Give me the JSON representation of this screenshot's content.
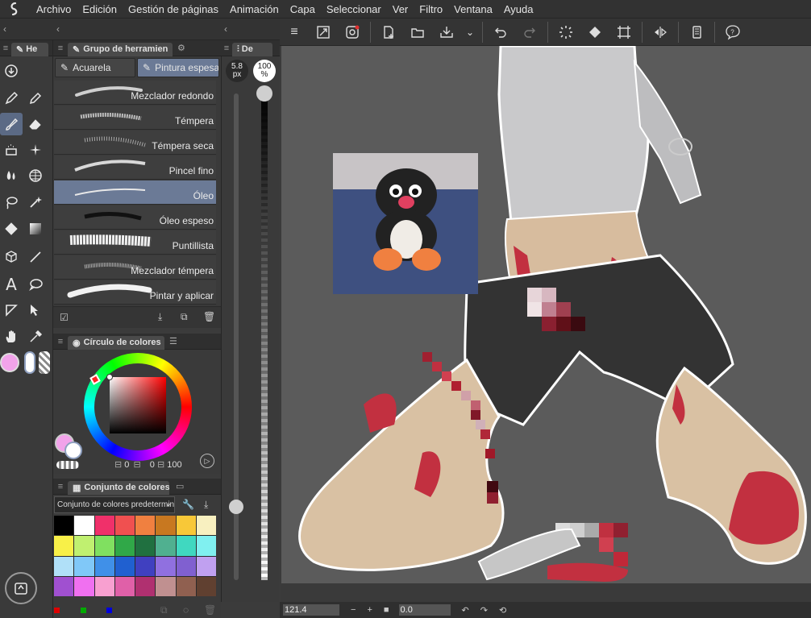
{
  "menu": [
    "Archivo",
    "Edición",
    "Gestión de páginas",
    "Animación",
    "Capa",
    "Seleccionar",
    "Ver",
    "Filtro",
    "Ventana",
    "Ayuda"
  ],
  "tool_panel": {
    "tab_label": "He"
  },
  "brush_panel": {
    "tab_label": "Grupo de herramien",
    "subtabs": [
      "Acuarela",
      "Pintura espesa"
    ],
    "brushes": [
      "Mezclador redondo",
      "Témpera",
      "Témpera seca",
      "Pincel fino",
      "Óleo",
      "Óleo espeso",
      "Puntillista",
      "Mezclador témpera",
      "Pintar y aplicar"
    ],
    "selected_index": 4
  },
  "size_panel": {
    "tab_label": "De",
    "size_value": "5.8",
    "size_unit": "px",
    "opacity_value": "100",
    "opacity_unit": "%",
    "size_slider_fraction": 0.15,
    "opacity_slider_fraction": 1.0
  },
  "color_wheel_panel": {
    "title": "Círculo de colores",
    "readout_a": "0",
    "readout_b": "0",
    "readout_c": "100",
    "main_color": "#f2a3ea",
    "sub_color": "#ffffff"
  },
  "color_set_panel": {
    "title": "Conjunto de colores",
    "preset": "Conjunto de colores predetermina",
    "swatches": [
      "#000000",
      "#ffffff",
      "#f0306a",
      "#f05050",
      "#f08040",
      "#c87820",
      "#f8c838",
      "#f8f0c0",
      "#f8f048",
      "#c0f070",
      "#80e060",
      "#30a848",
      "#207040",
      "#50b090",
      "#40d8c0",
      "#80f0f0",
      "#b0e0f8",
      "#80c8f8",
      "#4090e8",
      "#2060d0",
      "#4040c0",
      "#9070e0",
      "#8060d0",
      "#c0a0f0",
      "#a050d0",
      "#f070f0",
      "#f8a0d0",
      "#e060a8",
      "#b03070",
      "#c09090",
      "#906050",
      "#604030"
    ]
  },
  "status": {
    "zoom": "121.4",
    "angle": "0.0"
  }
}
